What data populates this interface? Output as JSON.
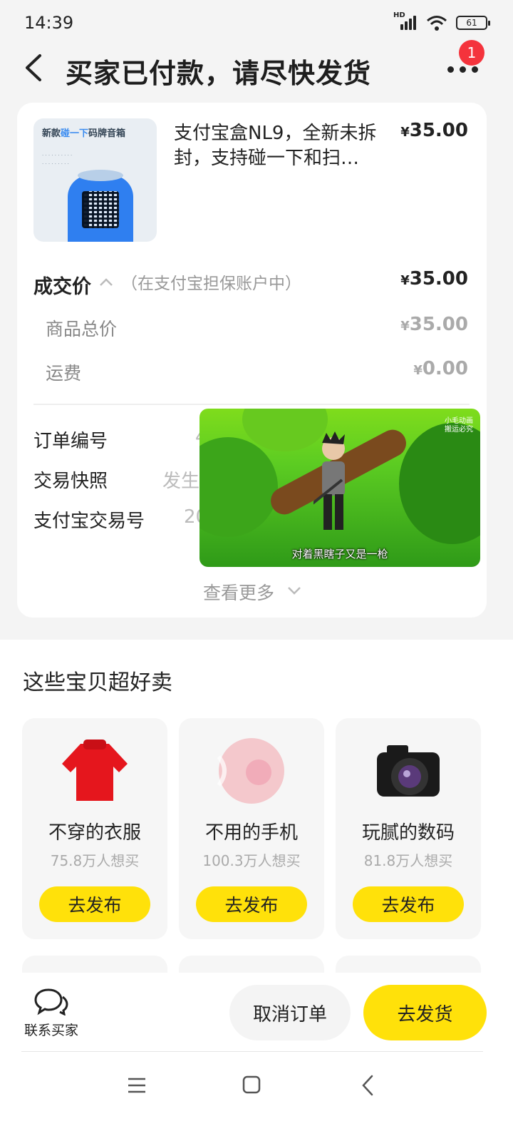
{
  "status_bar": {
    "time": "14:39",
    "network": "HD",
    "battery": "61"
  },
  "header": {
    "title": "买家已付款，请尽快发货",
    "notification_count": "1"
  },
  "order": {
    "thumb_caption_prefix": "新款",
    "thumb_caption_highlight": "碰一下",
    "thumb_caption_suffix": "码牌音箱",
    "item_title": "支付宝盒NL9，全新未拆封，支持碰一下和扫…",
    "item_price": "35.00",
    "currency": "¥",
    "deal_label": "成交价",
    "deal_note": "（在支付宝担保账户中）",
    "deal_price": "35.00",
    "goods_total_label": "商品总价",
    "goods_total": "35.00",
    "shipping_label": "运费",
    "shipping": "0.00",
    "order_no_label": "订单编号",
    "order_no_partial": "4",
    "snapshot_label": "交易快照",
    "snapshot_partial": "发生",
    "alipay_no_label": "支付宝交易号",
    "alipay_no_partial": "20",
    "see_more": "查看更多"
  },
  "video": {
    "watermark_line1": "小毛动画",
    "watermark_line2": "搬运必究",
    "subtitle": "对着黑瞎子又是一枪"
  },
  "recommend": {
    "title": "这些宝贝超好卖",
    "items": [
      {
        "name": "不穿的衣服",
        "want": "75.8万人想买",
        "button": "去发布"
      },
      {
        "name": "不用的手机",
        "want": "100.3万人想买",
        "button": "去发布"
      },
      {
        "name": "玩腻的数码",
        "want": "81.8万人想买",
        "button": "去发布"
      }
    ]
  },
  "actions": {
    "contact": "联系买家",
    "cancel": "取消订单",
    "ship": "去发货"
  },
  "colors": {
    "accent_yellow": "#ffe10a",
    "badge_red": "#f4333c"
  }
}
